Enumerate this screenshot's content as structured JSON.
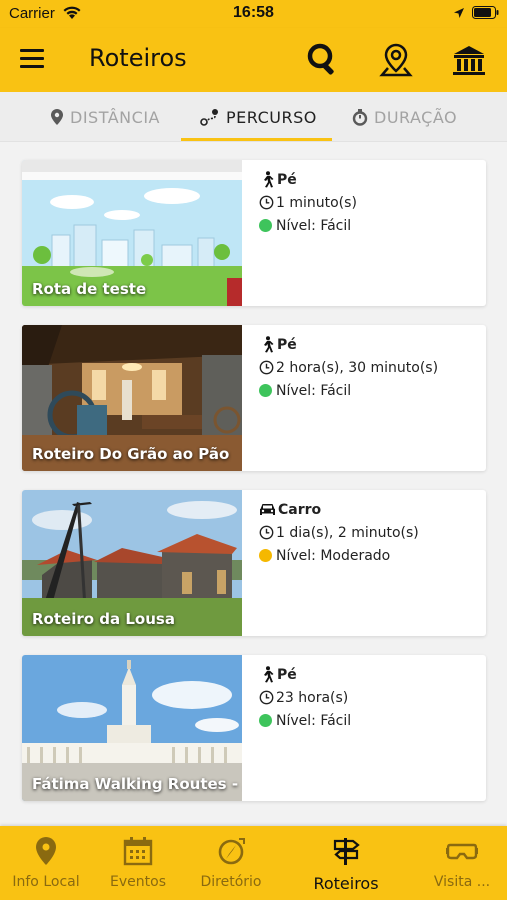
{
  "status_bar": {
    "carrier": "Carrier",
    "time": "16:58",
    "icons": [
      "wifi-icon",
      "location-arrow-icon",
      "battery-icon"
    ]
  },
  "app_bar": {
    "title": "Roteiros",
    "actions": [
      "search-icon",
      "map-pin-icon",
      "museum-icon"
    ]
  },
  "sort_tabs": [
    {
      "label": "DISTÂNCIA",
      "icon": "location-pin-icon",
      "active": false
    },
    {
      "label": "PERCURSO",
      "icon": "route-icon",
      "active": true
    },
    {
      "label": "DURAÇÃO",
      "icon": "stopwatch-icon",
      "active": false
    }
  ],
  "routes": [
    {
      "title": "Rota de teste",
      "mode": "Pé",
      "mode_icon": "walking-icon",
      "duration": "1 minuto(s)",
      "level": "Nível: Fácil",
      "level_color": "#3ec45c"
    },
    {
      "title": "Roteiro Do Grão ao Pão",
      "mode": "Pé",
      "mode_icon": "walking-icon",
      "duration": "2 hora(s), 30 minuto(s)",
      "level": "Nível: Fácil",
      "level_color": "#3ec45c"
    },
    {
      "title": "Roteiro da Lousa",
      "mode": "Carro",
      "mode_icon": "car-icon",
      "duration": "1 dia(s), 2 minuto(s)",
      "level": "Nível: Moderado",
      "level_color": "#f5b800"
    },
    {
      "title": "Fátima Walking Routes - ...",
      "mode": "Pé",
      "mode_icon": "walking-icon",
      "duration": "23 hora(s)",
      "level": "Nível: Fácil",
      "level_color": "#3ec45c"
    }
  ],
  "bottom_nav": [
    {
      "label": "Info Local",
      "icon": "map-marker-icon",
      "active": false
    },
    {
      "label": "Eventos",
      "icon": "calendar-icon",
      "active": false
    },
    {
      "label": "Diretório",
      "icon": "compass-icon",
      "active": false
    },
    {
      "label": "Roteiros",
      "icon": "signpost-icon",
      "active": true
    },
    {
      "label": "Visita ...",
      "icon": "vr-headset-icon",
      "active": false
    }
  ],
  "colors": {
    "accent": "#f9c213",
    "easy": "#3ec45c",
    "moderate": "#f5b800",
    "inactive_tab": "#a3a3a3"
  }
}
